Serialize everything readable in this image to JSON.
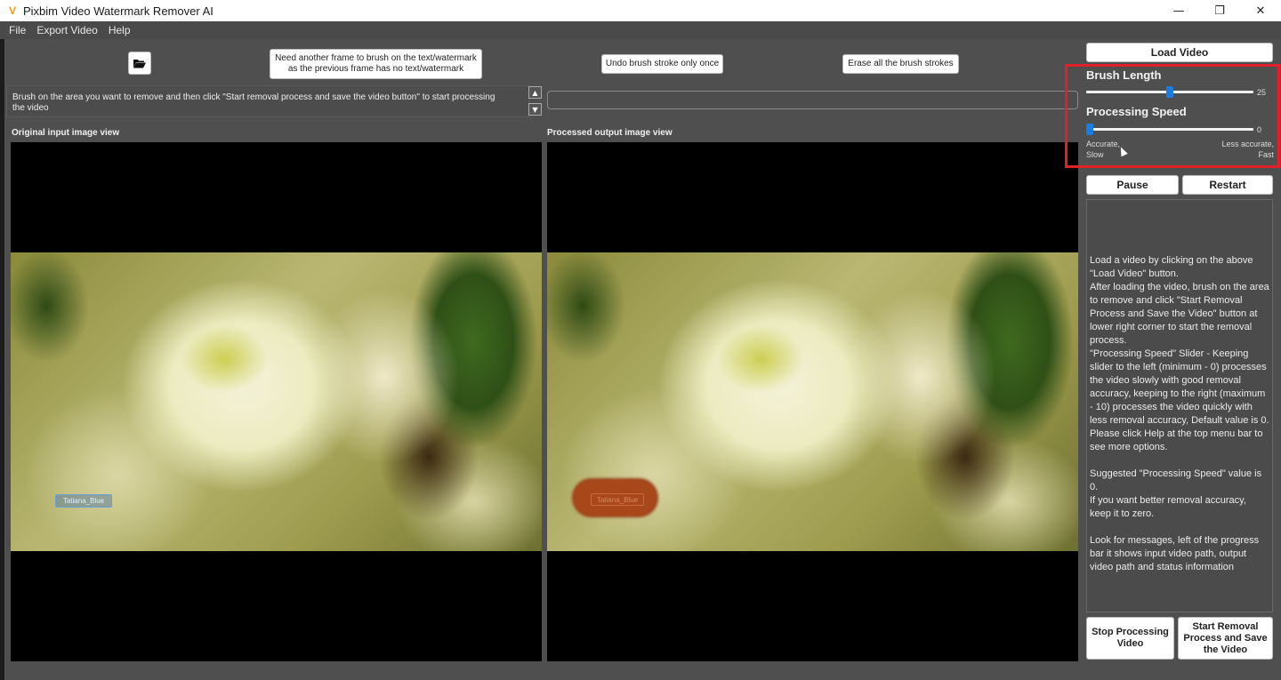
{
  "window": {
    "title": "Pixbim Video Watermark Remover AI",
    "logo_glyph": "V",
    "controls": {
      "minimize": "—",
      "maximize": "❐",
      "close": "✕"
    }
  },
  "menu": {
    "items": [
      {
        "label": "File"
      },
      {
        "label": "Export Video"
      },
      {
        "label": "Help"
      }
    ]
  },
  "toolbar": {
    "open_folder_icon": "folder-open-icon",
    "need_frame_label_line1": "Need another frame to brush on the text/watermark",
    "need_frame_label_line2": "as the previous frame has no text/watermark",
    "undo_label": "Undo brush stroke only once",
    "erase_label": "Erase all the brush strokes"
  },
  "messages": {
    "text": "Brush on the area you want to remove and then click \"Start removal process and save the video button\" to start processing the video",
    "scroll_up": "▲",
    "scroll_down": "▼"
  },
  "progress": {
    "value": 0
  },
  "views": {
    "original_label": "Original input image view",
    "processed_label": "Processed output image view",
    "watermark_text": "Tatiana_Blue"
  },
  "controls": {
    "load_video_label": "Load Video",
    "brush_length": {
      "label": "Brush Length",
      "value": 25,
      "min": 0,
      "max": 50
    },
    "processing_speed": {
      "label": "Processing Speed",
      "value": 0,
      "min": 0,
      "max": 10
    },
    "hint_left_line1": "Accurate,",
    "hint_left_line2": "Slow",
    "hint_right_line1": "Less accurate,",
    "hint_right_line2": "Fast",
    "pause_label": "Pause",
    "restart_label": "Restart",
    "stop_label": "Stop Processing Video",
    "start_label": "Start Removal Process and Save the Video",
    "highlight_color": "#e0202a",
    "slider_color": "#1b7ce3"
  },
  "info": {
    "paragraphs": [
      "Load a video by clicking on the above \"Load Video\" button.\nAfter loading the video, brush on the area to remove and click \"Start Removal Process and Save the Video\" button at lower right corner to start the removal process.\n\"Processing Speed\" Slider - Keeping slider to the left (minimum - 0) processes the video slowly with good removal accuracy, keeping to the right (maximum - 10) processes the video quickly with less removal accuracy, Default value is 0.\nPlease click Help at the top menu bar to see more options.",
      "Suggested \"Processing Speed\" value is 0.\nIf you want better removal accuracy, keep it to zero.",
      "Look for messages, left of the progress bar it shows input video path, output video path and status information"
    ]
  }
}
